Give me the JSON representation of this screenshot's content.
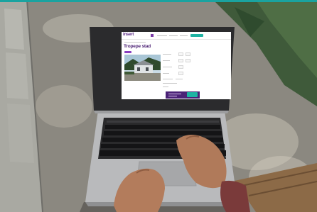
{
  "website": {
    "logo": "insert",
    "listing_title": "Tropepe",
    "listing_title_fragment": "stad"
  },
  "colors": {
    "brand_purple": "#5a2a86",
    "accent_teal": "#1fb3a3",
    "price_panel": "#4b2277"
  }
}
